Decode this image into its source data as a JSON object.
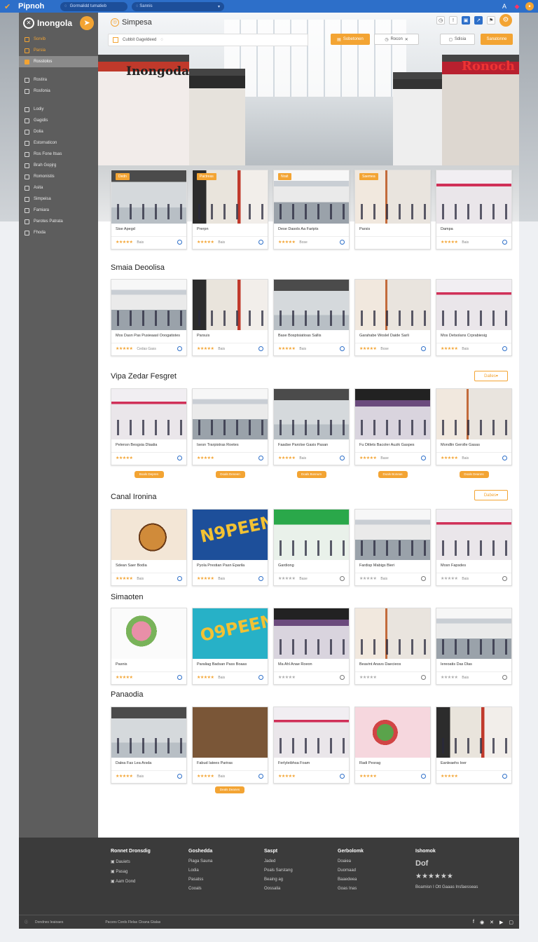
{
  "app": {
    "brand": "Pipnoh",
    "title": "Inongola"
  },
  "topbar": {
    "url1": "Gormalidd tumatieb",
    "url2": "Sannis"
  },
  "hero": {
    "page_title": "Simpesa",
    "search_placeholder": "Cubbit Gageldeed",
    "btn_primary": "Sobetonen",
    "btn_secondary1": "Rocon",
    "btn_secondary2": "Sdisia",
    "btn_cta": "Sanatonne",
    "sign_left": "Inongoda",
    "sign_right": "Ronoch"
  },
  "sidebar": {
    "items": [
      {
        "label": "Sorvib",
        "style": "orange"
      },
      {
        "label": "Parsia",
        "style": "orange"
      },
      {
        "label": "Rosstolos",
        "style": "active"
      },
      {
        "label": "Rostira",
        "style": ""
      },
      {
        "label": "Rosfonia",
        "style": ""
      },
      {
        "label": "Lodiy",
        "style": ""
      },
      {
        "label": "Gagidis",
        "style": ""
      },
      {
        "label": "Dolia",
        "style": ""
      },
      {
        "label": "Estornaticon",
        "style": ""
      },
      {
        "label": "Ros Fone Itsas",
        "style": ""
      },
      {
        "label": "Brah Gopjrg",
        "style": ""
      },
      {
        "label": "Romonistis",
        "style": ""
      },
      {
        "label": "Asita",
        "style": ""
      },
      {
        "label": "Simpeisa",
        "style": ""
      },
      {
        "label": "Famiara",
        "style": ""
      },
      {
        "label": "Parotes Patrata",
        "style": ""
      },
      {
        "label": "Fhoda",
        "style": ""
      }
    ]
  },
  "rows": [
    {
      "title": "",
      "tags": [
        "Dedn",
        "Pactreas",
        "Nrait",
        "Saemea",
        ""
      ],
      "cards": [
        {
          "cap": "Sise Apegd",
          "meta": "Bais"
        },
        {
          "cap": "Prerpn",
          "meta": "Bais"
        },
        {
          "cap": "Dese Dasols Aa Faripts",
          "meta": "Bose"
        },
        {
          "cap": "Parsis",
          "meta": ""
        },
        {
          "cap": "Dampa",
          "meta": "Bais"
        }
      ]
    },
    {
      "title": "Smaia Deoolisa",
      "cards": [
        {
          "cap": "Mos Dasn Pas Pusieaasl Ooogatistes",
          "meta": "Cedas Gass"
        },
        {
          "cap": "Parsuis",
          "meta": "Bais"
        },
        {
          "cap": "Base Bosptsiatioas Sallis",
          "meta": "Bais"
        },
        {
          "cap": "Garahabe Woslel Daide Sarli",
          "meta": "Bose"
        },
        {
          "cap": "Mos Detsolans Crprabiesig",
          "meta": "Bais"
        }
      ]
    },
    {
      "title": "Vipa Zedar Fesgret",
      "button": "Dalles",
      "cards": [
        {
          "cap": "Pelensn Besgsia Dlaalia",
          "meta": ""
        },
        {
          "cap": "Isesn Trarpistras Roetes",
          "meta": ""
        },
        {
          "cap": "Faadse Parolse Gasis Pasan",
          "meta": "Bais"
        },
        {
          "cap": "Fu Ditlets Bacoler Auzik Gaspes",
          "meta": "Base"
        },
        {
          "cap": "Mondlin Gerolle Gasas",
          "meta": "Bais"
        }
      ],
      "pills": [
        "Boals Depren",
        "Doals Deneen",
        "Doals Bosnum",
        "Doals Boneas",
        "Doals Deanns"
      ]
    },
    {
      "title": "Canal Ironina",
      "button": "Dabes",
      "cards": [
        {
          "cap": "Sdean Saer Bodia",
          "meta": "Bais"
        },
        {
          "cap": "Pyola Prestian Pasn Eparila",
          "meta": "Bais"
        },
        {
          "cap": "Gardiong",
          "meta": "Base"
        },
        {
          "cap": "Fardisp Mabigs Bieri",
          "meta": "Bais"
        },
        {
          "cap": "Mosn Fapsdes",
          "meta": "Bais"
        }
      ],
      "open_text": "N9PEEN"
    },
    {
      "title": "Simaoten",
      "cards": [
        {
          "cap": "Pasnis",
          "meta": ""
        },
        {
          "cap": "Paraliag Badsan Pass Boaas",
          "meta": "Bais"
        },
        {
          "cap": "Ma Ahl Anae Roeon",
          "meta": ""
        },
        {
          "cap": "Beavint Anavs Daecieos",
          "meta": ""
        },
        {
          "cap": "Iereoatis Das Dlas",
          "meta": "Bais"
        }
      ],
      "open_text": "O9PEEN"
    },
    {
      "title": "Panaodia",
      "cards": [
        {
          "cap": "Dalea Fas Lea Arsda",
          "meta": "Bais"
        },
        {
          "cap": "Fabud Iatees Pariras",
          "meta": "Bais"
        },
        {
          "cap": "Ferlyleibhsa Foam",
          "meta": ""
        },
        {
          "cap": "Radi Pesrag",
          "meta": ""
        },
        {
          "cap": "Eanleaehs Ioer",
          "meta": ""
        }
      ],
      "pill": "Deals Deanes"
    }
  ],
  "footer": {
    "col1": {
      "title": "Ronnet Dronsdig",
      "items": [
        "Dauiets",
        "Pasag",
        "Aam Dond"
      ]
    },
    "col2": {
      "title": "Goshedda",
      "items": [
        "Piaga Sauna",
        "Lodia",
        "Pasatss",
        "Cooals"
      ]
    },
    "col3": {
      "title": "Saspt",
      "items": [
        "Jaded",
        "Poals Sarstang",
        "Beaing ag",
        "Oossalia"
      ]
    },
    "col4": {
      "title": "Gerbolomk",
      "items": [
        "Doaiea",
        "Duomaad",
        "Baaedeea",
        "Goas Inas"
      ]
    },
    "col5": {
      "title": "Ishomok",
      "brand": "Dof",
      "stars": "★★★★★★",
      "sub": "Boamisn I Ott Gaaas Insfaesseas"
    },
    "bottom_left": "Dondnes Ieaioaes",
    "bottom_mid": "Pacsns Cords Flelas Cloana Gtalas"
  }
}
